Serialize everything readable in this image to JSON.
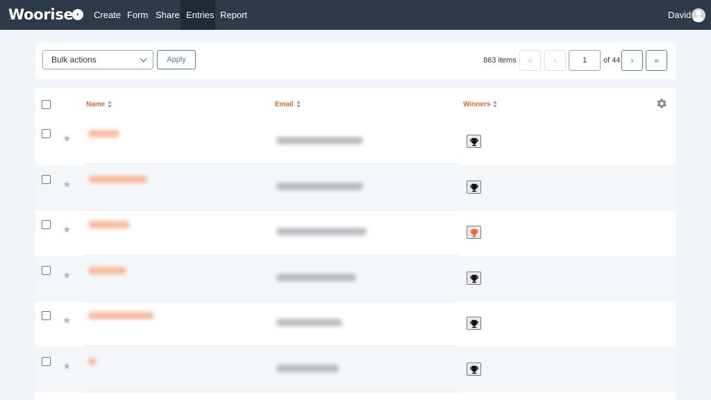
{
  "app": {
    "logo": "Woorise"
  },
  "nav": {
    "back_icon": "chevron-left-icon",
    "items": [
      {
        "label": "Create",
        "active": false
      },
      {
        "label": "Form",
        "active": false
      },
      {
        "label": "Share",
        "active": false
      },
      {
        "label": "Entries",
        "active": true
      },
      {
        "label": "Report",
        "active": false
      }
    ],
    "user": {
      "name": "David",
      "avatar_icon": "user-avatar-icon"
    }
  },
  "toolbar": {
    "bulk_actions": {
      "selected": "Bulk actions"
    },
    "apply_label": "Apply",
    "items_count": "863 items",
    "pagination": {
      "first": "«",
      "prev": "‹",
      "current_page": "1",
      "of_total": "of 44",
      "next": "›",
      "last": "»"
    }
  },
  "table": {
    "columns": {
      "name": "Name",
      "email": "Email",
      "winners": "Winners"
    },
    "settings_icon": "gear-icon",
    "rows": [
      {
        "winner": false
      },
      {
        "winner": false
      },
      {
        "winner": true
      },
      {
        "winner": false
      },
      {
        "winner": false
      },
      {
        "winner": false
      }
    ]
  },
  "colors": {
    "nav_bg": "#2c3a4a",
    "accent": "#f26522",
    "link": "#4a7cad",
    "page_bg": "#f1f5f9"
  }
}
